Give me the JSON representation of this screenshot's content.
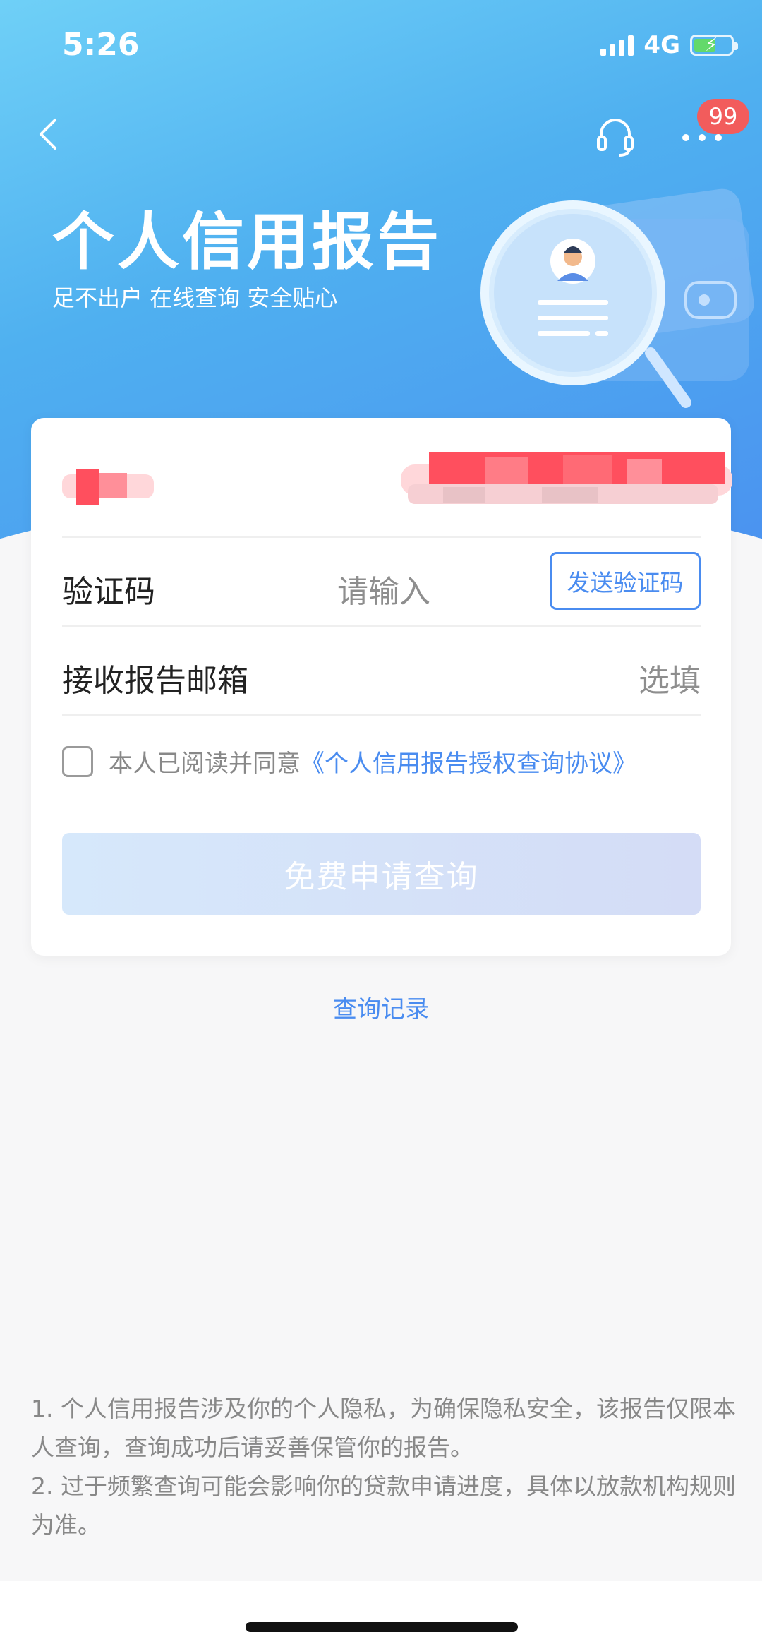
{
  "status_bar": {
    "time": "5:26",
    "network": "4G",
    "battery_percent": 60
  },
  "nav": {
    "badge_count": "99"
  },
  "hero": {
    "title": "个人信用报告",
    "subtitle": "足不出户 在线查询 安全贴心"
  },
  "form": {
    "code_label": "验证码",
    "code_placeholder": "请输入",
    "send_code_label": "发送验证码",
    "email_label": "接收报告邮箱",
    "email_placeholder": "选填",
    "agree_text": "本人已阅读并同意",
    "agree_link": "《个人信用报告授权查询协议》",
    "agree_checked": false,
    "submit_label": "免费申请查询"
  },
  "history_link": "查询记录",
  "notes": [
    "1. 个人信用报告涉及你的个人隐私，为确保隐私安全，该报告仅限本人查询，查询成功后请妥善保管你的报告。",
    "2. 过于频繁查询可能会影响你的贷款申请进度，具体以放款机构规则为准。"
  ],
  "colors": {
    "accent": "#4a8cf0",
    "badge": "#f25c5c",
    "redaction": "#ff4f5e"
  }
}
